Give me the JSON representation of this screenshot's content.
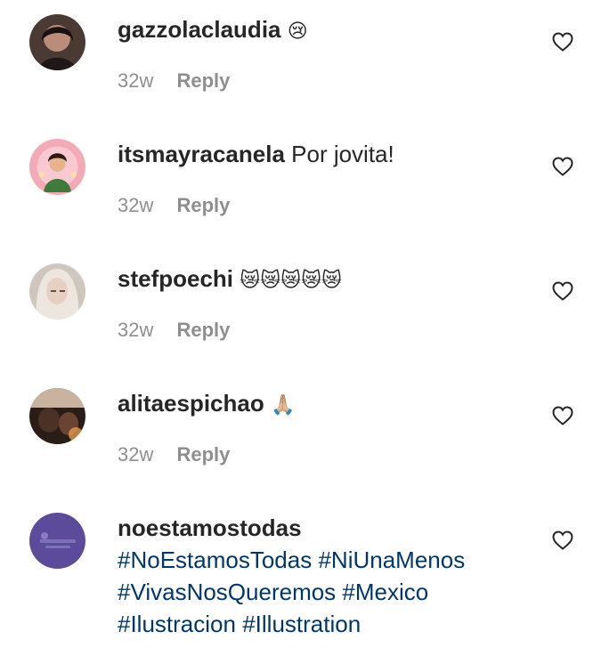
{
  "comments": [
    {
      "username": "gazzolaclaudia",
      "text": "",
      "emoji": "😢",
      "time": "32w",
      "reply_label": "Reply",
      "avatar_icon": "profile-photo-woman",
      "avatar_color": "#3d2f2a"
    },
    {
      "username": "itsmayracanela",
      "text": "Por jovita!",
      "emoji": "",
      "time": "32w",
      "reply_label": "Reply",
      "avatar_icon": "illustrated-portrait",
      "avatar_color": "#f3a9b6"
    },
    {
      "username": "stefpoechi",
      "text": "",
      "emoji": "😿😿😿😿😿",
      "time": "32w",
      "reply_label": "Reply",
      "avatar_icon": "profile-photo-blonde",
      "avatar_color": "#d8cfc8"
    },
    {
      "username": "alitaespichao",
      "text": "",
      "emoji": "🙏🏼",
      "time": "32w",
      "reply_label": "Reply",
      "avatar_icon": "profile-photo-dark",
      "avatar_color": "#2a1c17"
    },
    {
      "username": "noestamostodas",
      "hashtag_lines": [
        [
          "#NoEstamosTodas",
          "#NiUnaMenos"
        ],
        [
          "#VivasNosQueremos",
          "#Mexico"
        ],
        [
          "#Ilustracion",
          "#Illustration"
        ]
      ],
      "avatar_icon": "purple-logo",
      "avatar_color": "#5b4b9a"
    }
  ],
  "colors": {
    "text": "#262626",
    "meta": "#8e8e8e",
    "hashtag": "#00376b"
  }
}
